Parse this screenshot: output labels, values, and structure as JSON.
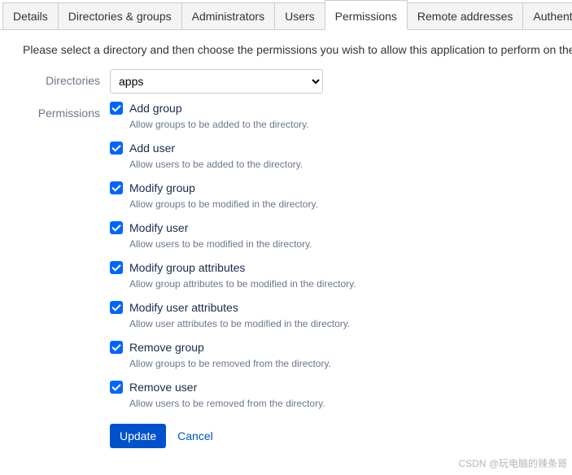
{
  "tabs": [
    {
      "label": "Details",
      "active": false
    },
    {
      "label": "Directories & groups",
      "active": false
    },
    {
      "label": "Administrators",
      "active": false
    },
    {
      "label": "Users",
      "active": false
    },
    {
      "label": "Permissions",
      "active": true
    },
    {
      "label": "Remote addresses",
      "active": false
    },
    {
      "label": "Authent",
      "active": false
    }
  ],
  "intro": "Please select a directory and then choose the permissions you wish to allow this application to perform on the s",
  "labels": {
    "directories": "Directories",
    "permissions": "Permissions"
  },
  "directory": {
    "selected": "apps"
  },
  "permissions": [
    {
      "label": "Add group",
      "desc": "Allow groups to be added to the directory.",
      "checked": true
    },
    {
      "label": "Add user",
      "desc": "Allow users to be added to the directory.",
      "checked": true
    },
    {
      "label": "Modify group",
      "desc": "Allow groups to be modified in the directory.",
      "checked": true
    },
    {
      "label": "Modify user",
      "desc": "Allow users to be modified in the directory.",
      "checked": true
    },
    {
      "label": "Modify group attributes",
      "desc": "Allow group attributes to be modified in the directory.",
      "checked": true
    },
    {
      "label": "Modify user attributes",
      "desc": "Allow user attributes to be modified in the directory.",
      "checked": true
    },
    {
      "label": "Remove group",
      "desc": "Allow groups to be removed from the directory.",
      "checked": true
    },
    {
      "label": "Remove user",
      "desc": "Allow users to be removed from the directory.",
      "checked": true
    }
  ],
  "actions": {
    "update": "Update",
    "cancel": "Cancel"
  },
  "watermark": "CSDN @玩电脑的辣条哥"
}
